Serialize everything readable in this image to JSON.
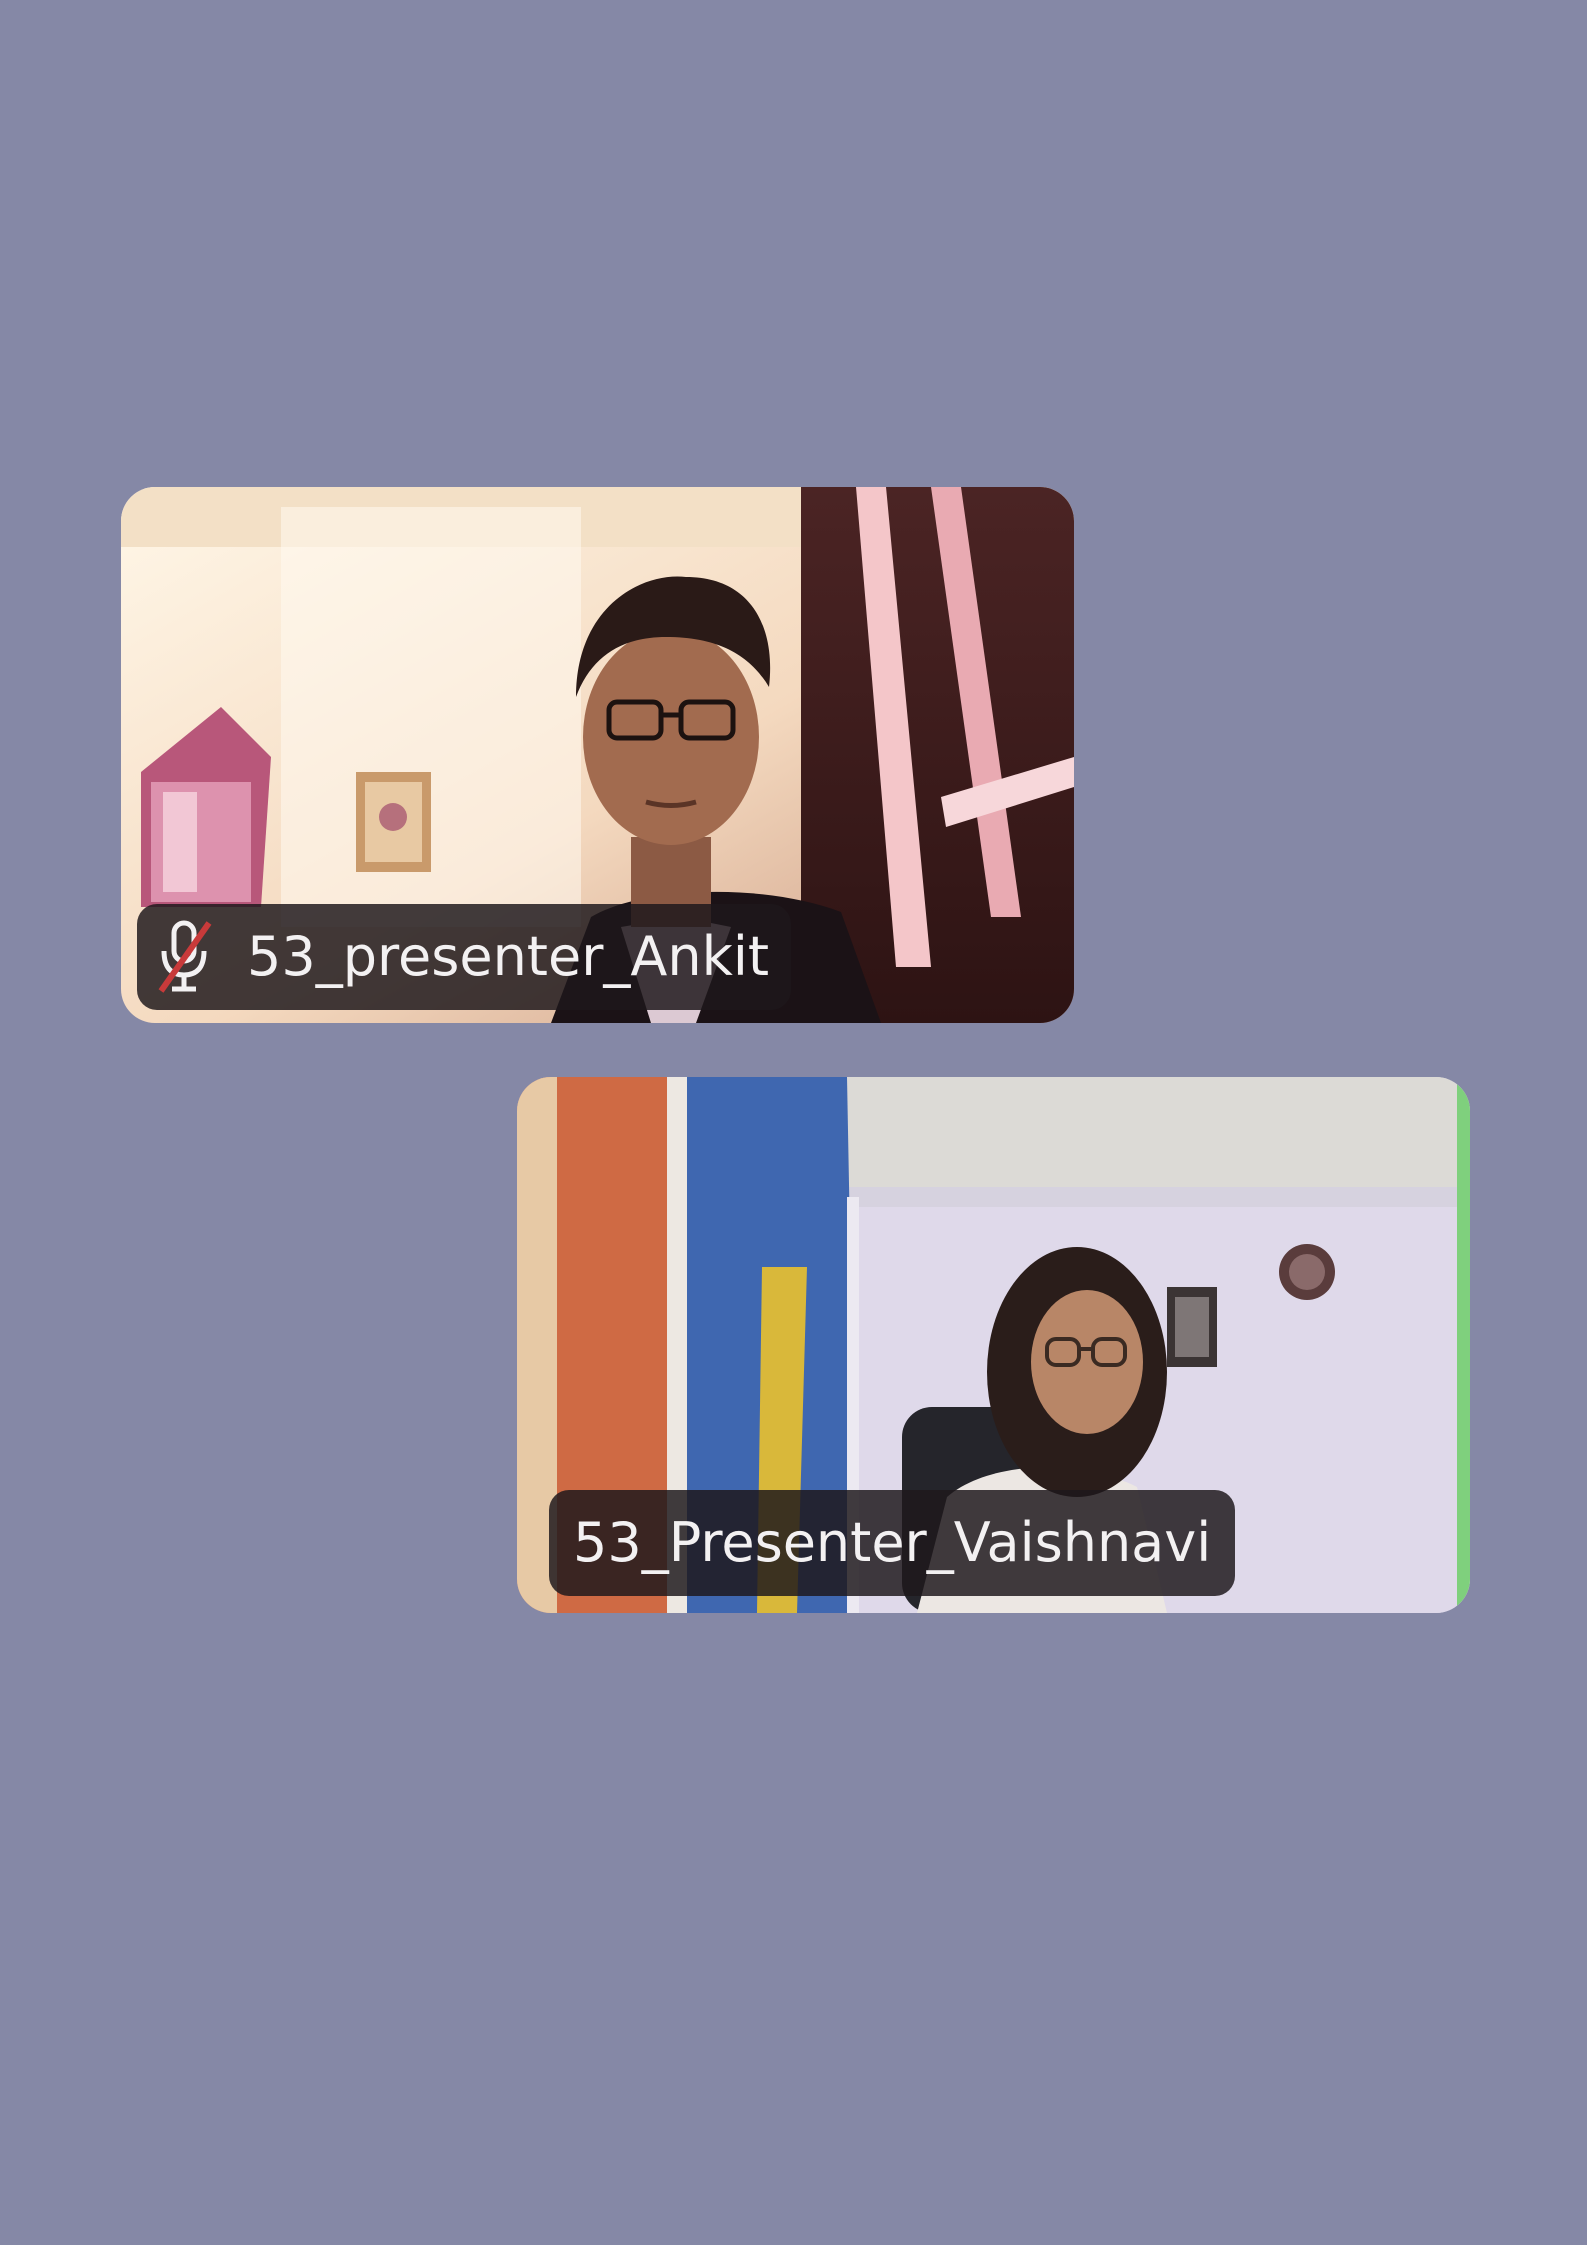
{
  "participants": [
    {
      "name": "53_presenter_Ankit",
      "muted": true,
      "icon": "mic-muted-icon"
    },
    {
      "name": "53_Presenter_Vaishnavi",
      "muted": false
    }
  ],
  "colors": {
    "background": "#8588a6",
    "name_tag": "#1e181c",
    "muted_slash": "#c83a3a"
  }
}
